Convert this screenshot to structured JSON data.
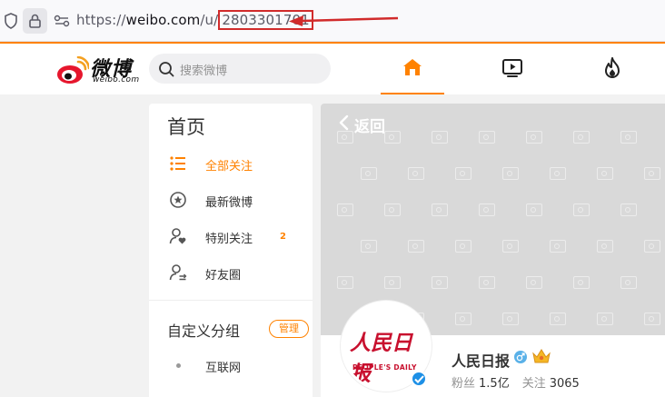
{
  "browser": {
    "url_prefix": "https://",
    "url_host": "weibo.com",
    "url_path": "/u/",
    "url_id": "2803301701"
  },
  "header": {
    "logo_text": "微博",
    "logo_sub": "weibo.com",
    "search_placeholder": "搜索微博"
  },
  "sidebar": {
    "title": "首页",
    "items": [
      {
        "label": "全部关注",
        "icon": "list-icon",
        "active": true
      },
      {
        "label": "最新微博",
        "icon": "star-circle-icon"
      },
      {
        "label": "特别关注",
        "icon": "user-heart-icon",
        "badge": "2"
      },
      {
        "label": "好友圈",
        "icon": "user-friends-icon"
      }
    ],
    "custom_group_title": "自定义分组",
    "manage_label": "管理",
    "group_items": [
      "互联网"
    ]
  },
  "profile": {
    "back_label": "返回",
    "avatar_text_cn": "人民日报",
    "avatar_text_en": "PEOPLE'S DAILY",
    "name": "人民日报",
    "fans_label": "粉丝",
    "fans_value": "1.5亿",
    "following_label": "关注",
    "following_value": "3065"
  },
  "colors": {
    "accent": "#ff8200",
    "highlight_box": "#d12b2b",
    "verified": "#1e90e6"
  }
}
